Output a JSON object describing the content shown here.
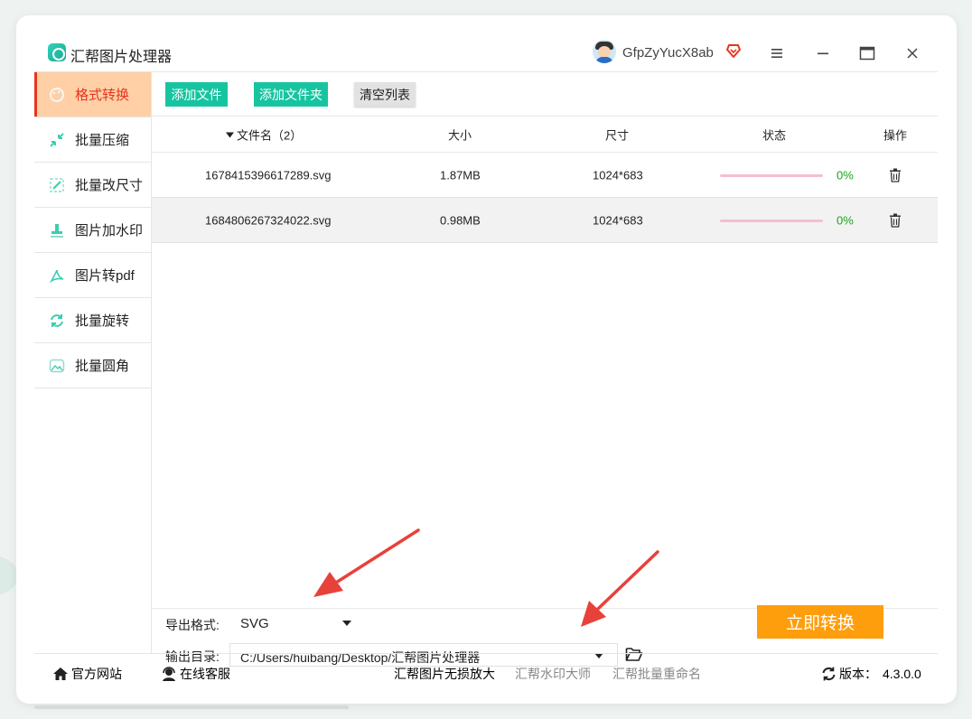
{
  "app": {
    "title": "汇帮图片处理器",
    "username": "GfpZyYucX8ab"
  },
  "toolbar": {
    "add_file": "添加文件",
    "add_folder": "添加文件夹",
    "clear_list": "清空列表"
  },
  "sidebar": {
    "items": [
      {
        "label": "格式转换",
        "icon": "palette-icon",
        "active": true
      },
      {
        "label": "批量压缩",
        "icon": "compress-icon",
        "active": false
      },
      {
        "label": "批量改尺寸",
        "icon": "resize-icon",
        "active": false
      },
      {
        "label": "图片加水印",
        "icon": "stamp-icon",
        "active": false
      },
      {
        "label": "图片转pdf",
        "icon": "pdf-icon",
        "active": false
      },
      {
        "label": "批量旋转",
        "icon": "rotate-icon",
        "active": false
      },
      {
        "label": "批量圆角",
        "icon": "image-corner-icon",
        "active": false
      }
    ]
  },
  "table": {
    "headers": {
      "name": "文件名（2）",
      "size": "大小",
      "dimension": "尺寸",
      "status": "状态",
      "action": "操作"
    },
    "rows": [
      {
        "name": "1678415396617289.svg",
        "size": "1.87MB",
        "dimension": "1024*683",
        "progress": "0%"
      },
      {
        "name": "1684806267324022.svg",
        "size": "0.98MB",
        "dimension": "1024*683",
        "progress": "0%"
      }
    ]
  },
  "export": {
    "format_label": "导出格式:",
    "format_value": "SVG",
    "dir_label": "输出目录:",
    "dir_value": "C:/Users/huibang/Desktop/汇帮图片处理器"
  },
  "convert_button": "立即转换",
  "footer": {
    "website": "官方网站",
    "service": "在线客服",
    "link1": "汇帮图片无损放大",
    "link2": "汇帮水印大师",
    "link3": "汇帮批量重命名",
    "version_label": "版本：",
    "version": "4.3.0.0"
  },
  "colors": {
    "accent_green": "#17c4a0",
    "active_bg": "#ffcfa6",
    "active_text": "#e8341c",
    "convert_orange": "#ff9e0d",
    "annotation_red": "#e8413a"
  }
}
